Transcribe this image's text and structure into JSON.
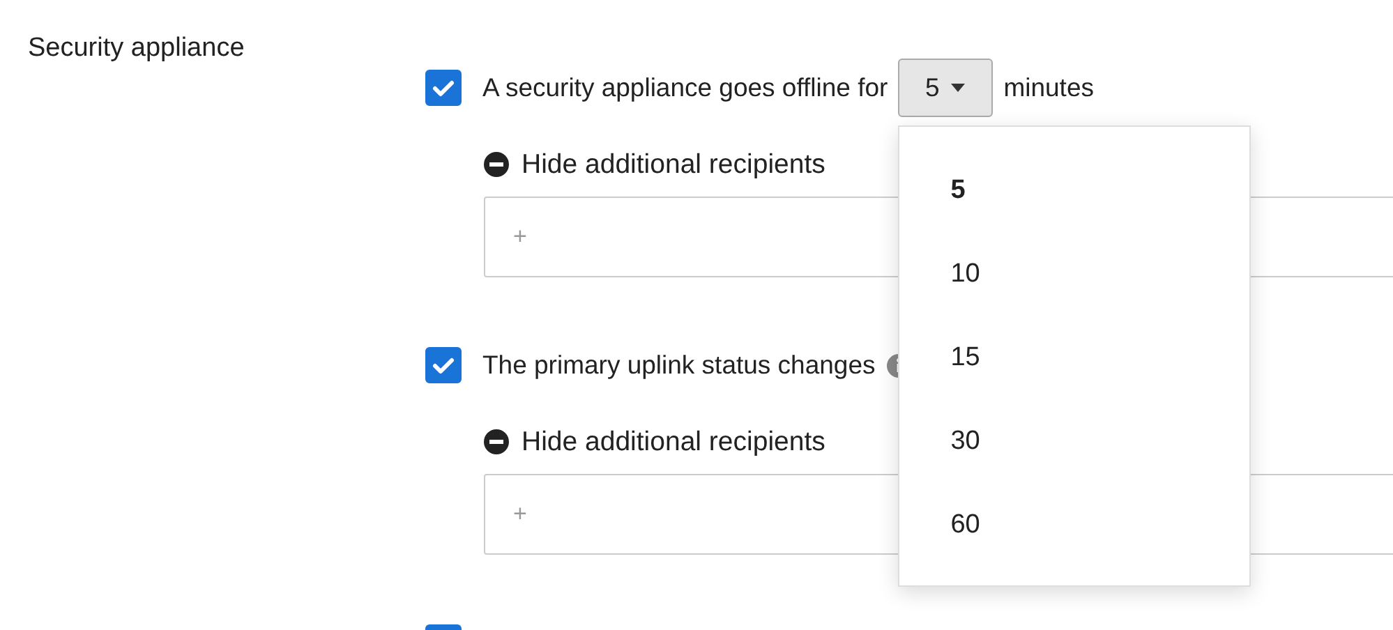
{
  "section": {
    "title": "Security appliance"
  },
  "alerts": [
    {
      "kind": "threshold",
      "checked": true,
      "label": "A security appliance goes offline for",
      "dropdown": {
        "value": "5",
        "expanded": true,
        "options": [
          {
            "label": "5",
            "selected": true
          },
          {
            "label": "10",
            "selected": false
          },
          {
            "label": "15",
            "selected": false
          },
          {
            "label": "30",
            "selected": false
          },
          {
            "label": "60",
            "selected": false
          }
        ]
      },
      "unit": "minutes",
      "recipients_toggle": "Hide additional recipients",
      "recipients_field": {
        "placeholder": "+"
      }
    },
    {
      "kind": "plain",
      "checked": true,
      "label": "The primary uplink status changes",
      "info": true,
      "recipients_toggle": "Hide additional recipients",
      "recipients_field": {
        "placeholder": "+"
      }
    },
    {
      "kind": "plain",
      "checked": true
    }
  ]
}
